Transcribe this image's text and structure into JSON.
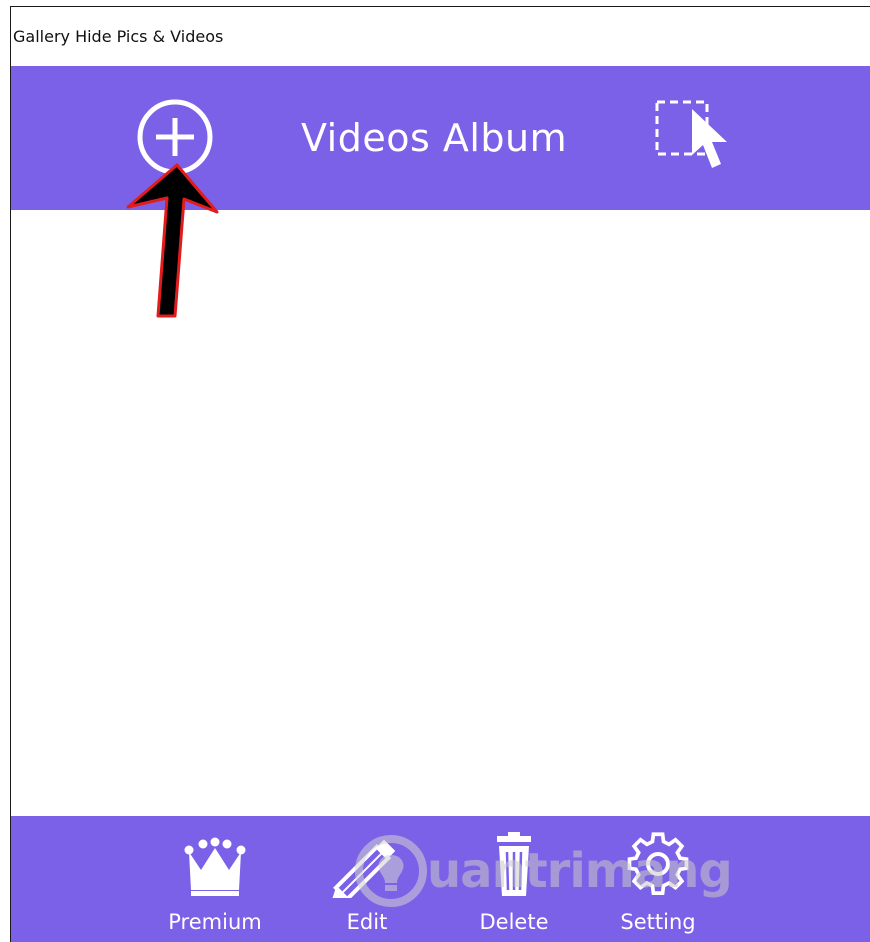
{
  "window": {
    "title": "Gallery Hide Pics & Videos"
  },
  "header": {
    "title": "Videos Album",
    "add_icon": "plus-circle-icon",
    "select_icon": "select-cursor-icon",
    "background_color": "#7b61e8"
  },
  "annotation": {
    "type": "arrow",
    "icon": "annotation-arrow-icon",
    "fill_color": "#000000",
    "outline_color": "#e11c1c"
  },
  "footer": {
    "background_color": "#7b61e8",
    "items": [
      {
        "label": "Premium",
        "icon": "crown-icon"
      },
      {
        "label": "Edit",
        "icon": "pencil-icon"
      },
      {
        "label": "Delete",
        "icon": "trash-icon"
      },
      {
        "label": "Setting",
        "icon": "gear-icon"
      }
    ]
  },
  "watermark": {
    "text": "uantrimang",
    "icon": "quantrimang-logo-icon"
  }
}
